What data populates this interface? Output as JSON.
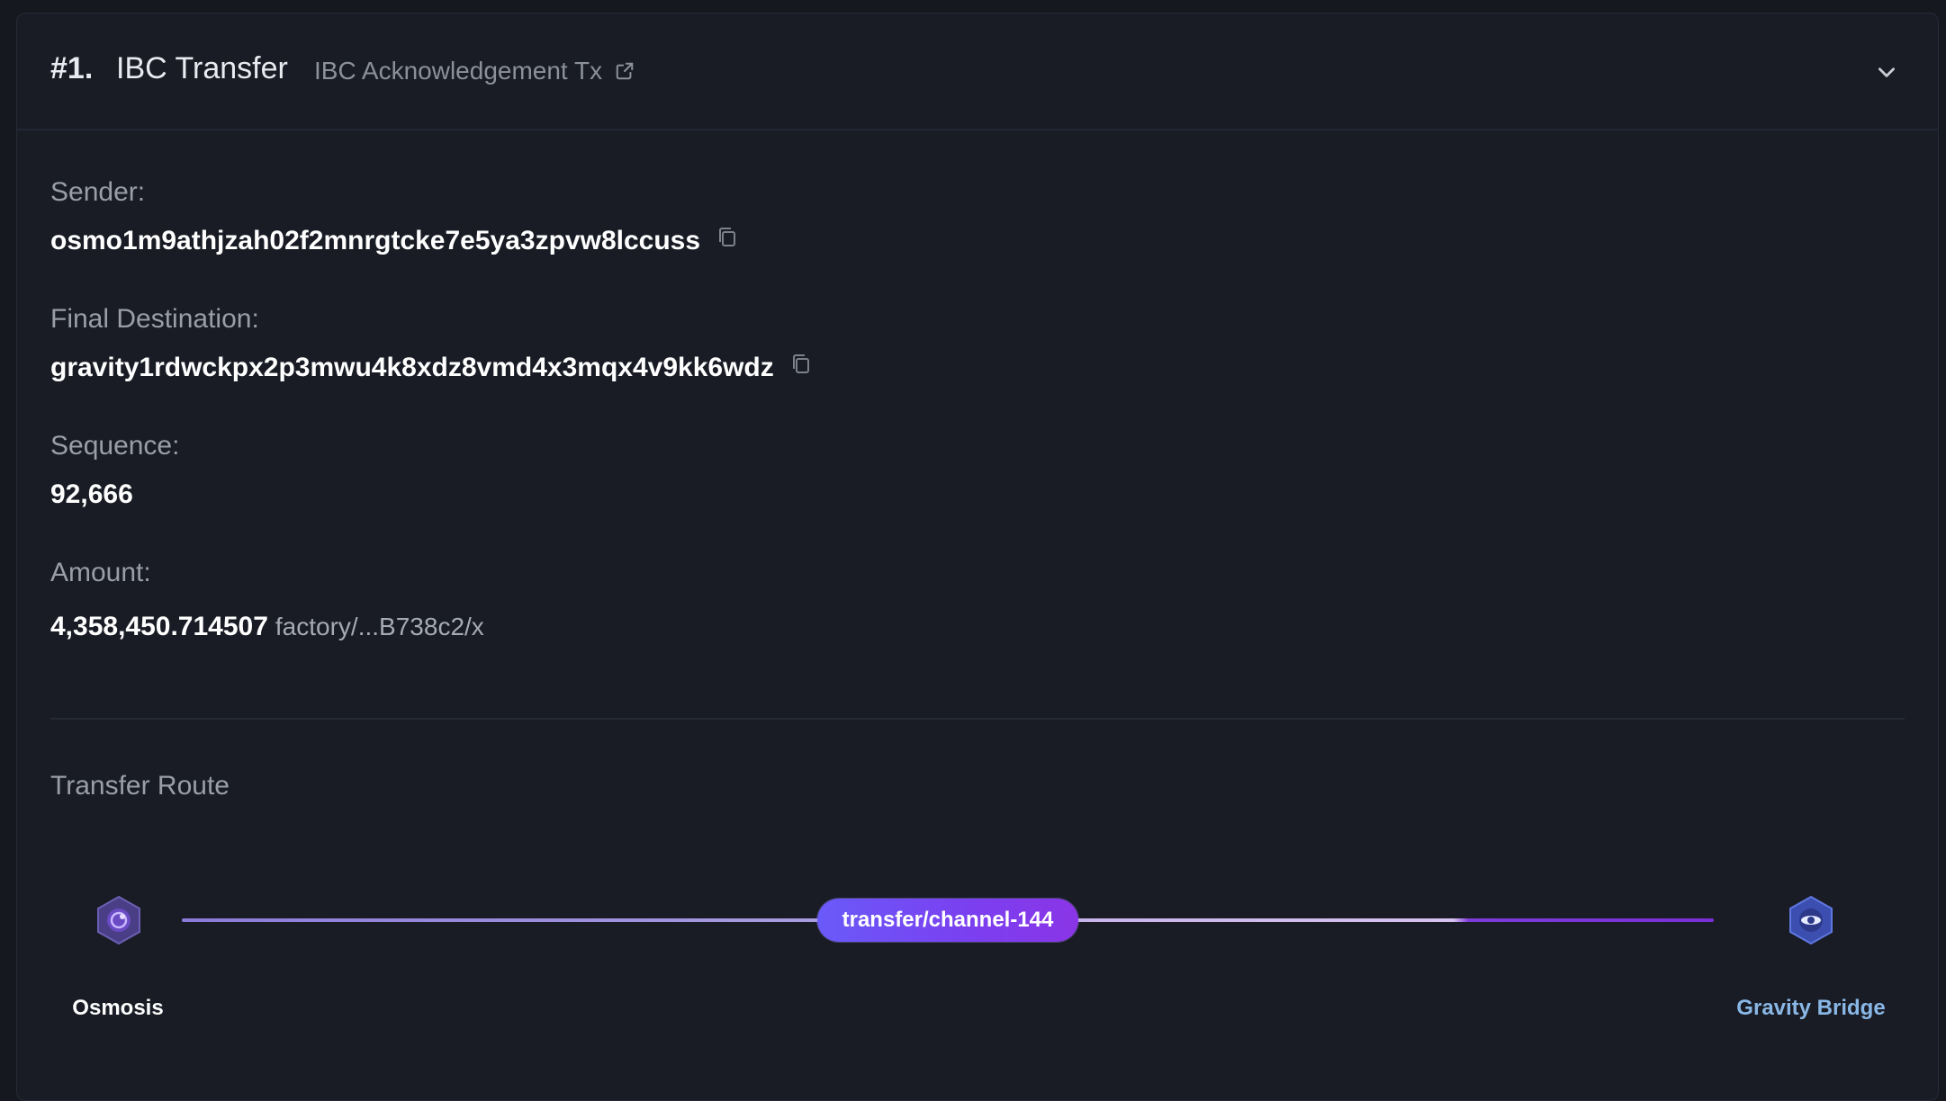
{
  "header": {
    "index": "#1.",
    "title": "IBC Transfer",
    "ack_link": "IBC Acknowledgement Tx"
  },
  "fields": {
    "sender": {
      "label": "Sender:",
      "value": "osmo1m9athjzah02f2mnrgtcke7e5ya3zpvw8lccuss"
    },
    "destination": {
      "label": "Final Destination:",
      "value": "gravity1rdwckpx2p3mwu4k8xdz8vmd4x3mqx4v9kk6wdz"
    },
    "sequence": {
      "label": "Sequence:",
      "value": "92,666"
    },
    "amount": {
      "label": "Amount:",
      "value": "4,358,450.714507",
      "denom": "factory/...B738c2/x"
    }
  },
  "route": {
    "title": "Transfer Route",
    "channel": "transfer/channel-144",
    "source": {
      "name": "Osmosis",
      "icon": "osmosis-icon"
    },
    "destination": {
      "name": "Gravity Bridge",
      "icon": "gravity-bridge-icon"
    }
  },
  "colors": {
    "background": "#15181f",
    "card": "#191c25",
    "accent": "#6a5af9",
    "destination_label": "#8ab8e6"
  }
}
